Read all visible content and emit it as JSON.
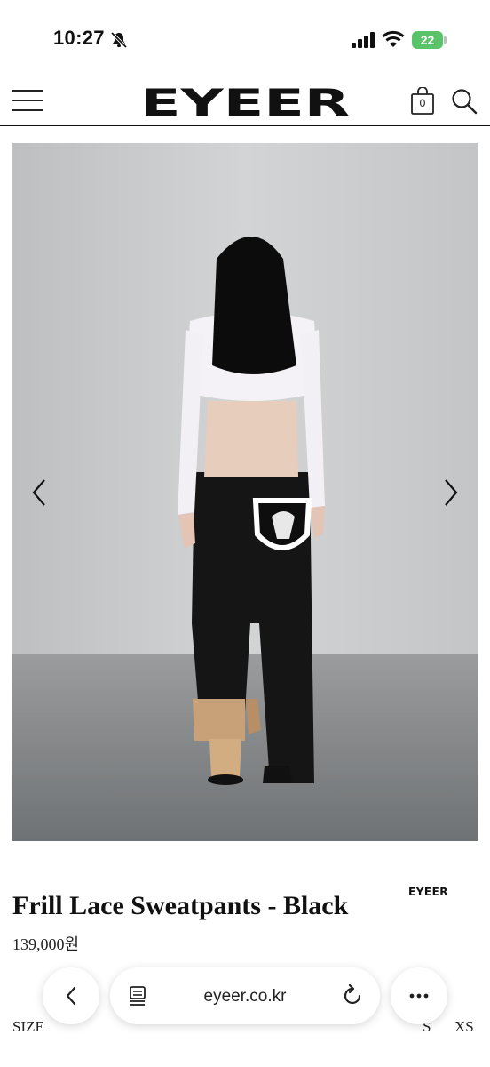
{
  "status_bar": {
    "time": "10:27",
    "battery": "22"
  },
  "header": {
    "logo_text": "EYEER",
    "cart_count": "0"
  },
  "hero": {
    "image": "model-back-view-frill-lace-sweatpants"
  },
  "product": {
    "brand": "EYEER",
    "title": "Frill Lace Sweatpants - Black",
    "price": "139,000원"
  },
  "size": {
    "label": "SIZE",
    "options": [
      "S",
      "XS"
    ]
  },
  "browser": {
    "url": "eyeer.co.kr"
  },
  "colors": {
    "battery": "#59c36a",
    "background": "#ffffff",
    "text": "#111111"
  },
  "icons": [
    "bell-slash-icon",
    "signal-icon",
    "wifi-icon",
    "menu-icon",
    "bag-icon",
    "search-icon",
    "chevron-left-icon",
    "chevron-right-icon",
    "tabs-icon",
    "reload-icon",
    "more-icon"
  ]
}
